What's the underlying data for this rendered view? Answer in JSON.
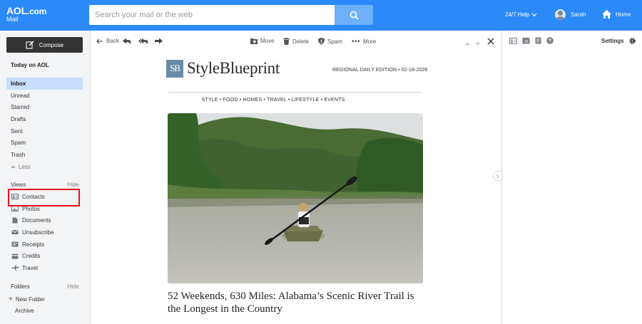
{
  "header": {
    "logo_brand": "AOL",
    "logo_domain": ".com",
    "logo_sub": "Mail",
    "search_placeholder": "Search your mail or the web",
    "help_label": "24/7 Help",
    "user_name": "Sarah",
    "home_label": "Home"
  },
  "sidebar": {
    "compose_label": "Compose",
    "today_label": "Today on AOL",
    "folders": [
      {
        "label": "Inbox",
        "active": true
      },
      {
        "label": "Unread"
      },
      {
        "label": "Starred"
      },
      {
        "label": "Drafts"
      },
      {
        "label": "Sent"
      },
      {
        "label": "Spam"
      },
      {
        "label": "Trash"
      },
      {
        "label": "Less"
      }
    ],
    "views_label": "Views",
    "views_hide": "Hide",
    "views": [
      {
        "label": "Contacts",
        "icon": "contacts-icon"
      },
      {
        "label": "Photos",
        "icon": "photos-icon"
      },
      {
        "label": "Documents",
        "icon": "documents-icon"
      },
      {
        "label": "Unsubscribe",
        "icon": "unsubscribe-icon"
      },
      {
        "label": "Receipts",
        "icon": "receipts-icon"
      },
      {
        "label": "Credits",
        "icon": "credits-icon"
      },
      {
        "label": "Travel",
        "icon": "travel-icon"
      }
    ],
    "folders_label": "Folders",
    "folders_hide": "Hide",
    "new_folder": "New Folder",
    "archive": "Archive"
  },
  "toolbar": {
    "back": "Back",
    "move": "Move",
    "delete": "Delete",
    "spam": "Spam",
    "more": "More"
  },
  "message": {
    "logo_mark": "SB",
    "logo_name": "StyleBlueprint",
    "edition": "REGIONAL DAILY EDITION • 02-18-2026",
    "nav": "STYLE • FOOD • HOMES • TRAVEL • LIFESTYLE • EVENTS",
    "headline": "52 Weekends, 630 Miles: Alabama’s Scenic River Trail is the Longest in the Country"
  },
  "right_panel": {
    "settings_label": "Settings"
  },
  "colors": {
    "header_blue": "#2b8af7",
    "active_folder": "#c7dffc",
    "highlight_red": "#e8111c"
  }
}
